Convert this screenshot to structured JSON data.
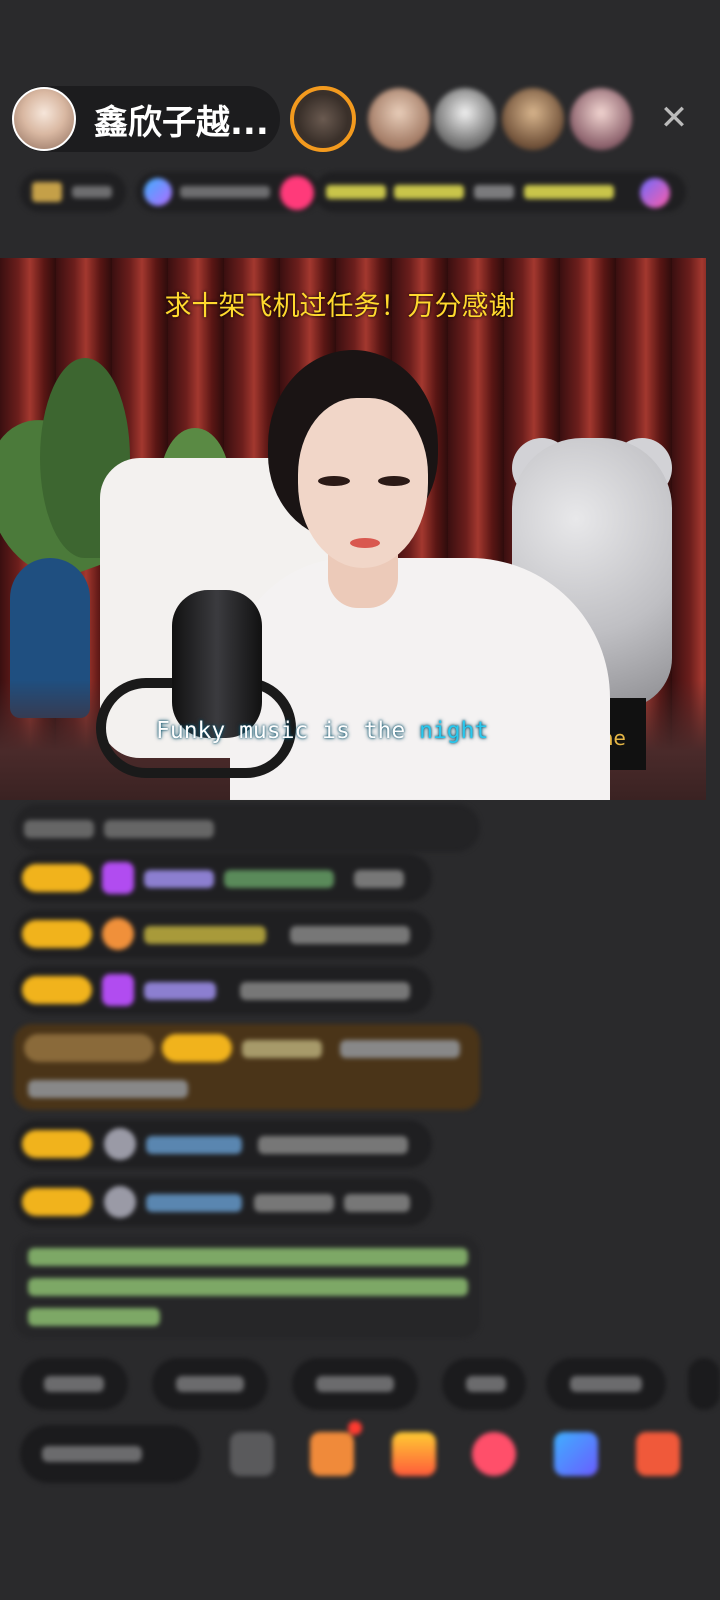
{
  "header": {
    "host_name": "鑫欣子越...",
    "viewers": [
      "viewer-avatar-1",
      "viewer-avatar-2",
      "viewer-avatar-3",
      "viewer-avatar-4",
      "viewer-avatar-5"
    ],
    "close_icon": "close-icon",
    "close_glyph": "✕"
  },
  "video": {
    "caption": "求十架飞机过任务！万分感谢",
    "lyric_prefix": "Funky music is the ",
    "lyric_highlight": "night",
    "box_sign": "me"
  },
  "colors": {
    "background": "#2a2a2c",
    "caption_yellow": "#ffd92e",
    "lyric_cyan": "#28c8ee",
    "badge_gold": "#f1b31c"
  }
}
